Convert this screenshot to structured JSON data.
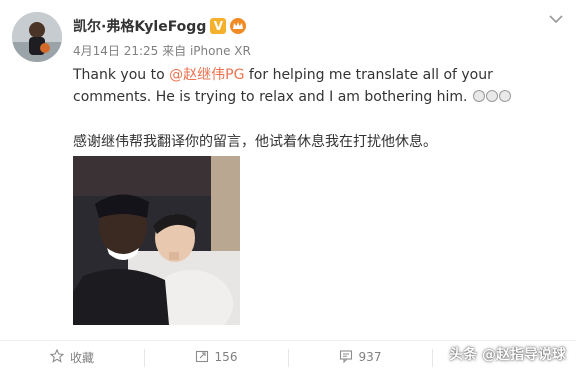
{
  "post": {
    "username": "凯尔·弗格KyleFogg",
    "verified_badge": "V",
    "date": "4月14日 21:25",
    "source": "来自 iPhone XR",
    "text_en_before": "Thank you to ",
    "mention": "@赵继伟PG",
    "text_en_after": " for helping me translate all of your comments. He is trying to relax and I am bothering him. ",
    "text_cn": "感谢继伟帮我翻译你的留言，他试着休息我在打扰他休息。"
  },
  "actions": {
    "favorite_label": "收藏",
    "repost_count": "156",
    "comment_count": "937"
  },
  "watermark": "头条 @赵指导说球",
  "icons": [
    "avatar",
    "verified-badge-icon",
    "crown-icon",
    "chevron-down-icon",
    "star-icon",
    "repost-icon",
    "comment-icon",
    "laugh-emoji-icon"
  ],
  "colors": {
    "mention": "#eb7350",
    "meta": "#808080",
    "text": "#333333",
    "badge": "#f6b12c"
  }
}
